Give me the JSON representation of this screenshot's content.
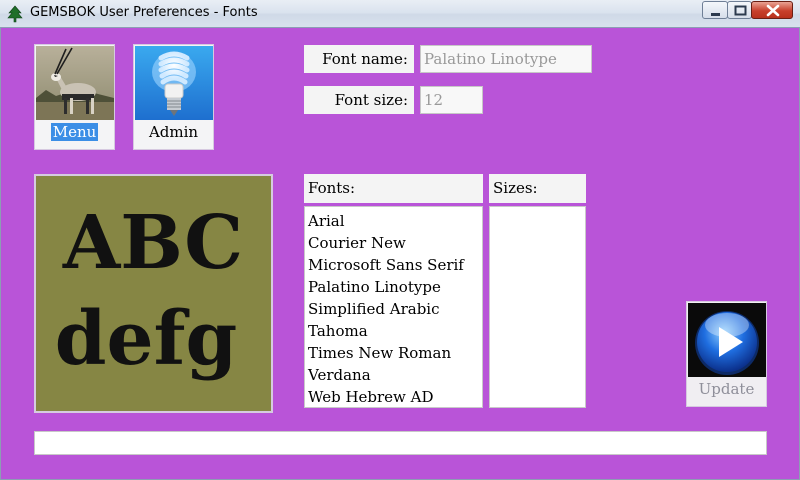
{
  "window": {
    "title": "GEMSBOK User Preferences - Fonts",
    "icon": "tree-icon"
  },
  "tiles": {
    "menu": {
      "label": "Menu",
      "icon": "gemsbok-photo",
      "selected": true
    },
    "admin": {
      "label": "Admin",
      "icon": "light-bulb-icon"
    },
    "update": {
      "label": "Update",
      "icon": "play-icon",
      "disabled": true
    }
  },
  "fields": {
    "font_name": {
      "label": "Font name:",
      "value": "Palatino Linotype"
    },
    "font_size": {
      "label": "Font size:",
      "value": "12"
    }
  },
  "preview": {
    "line1": "ABC",
    "line2": "defg",
    "background": "#868644"
  },
  "fonts_list": {
    "header": "Fonts:",
    "items": [
      "Arial",
      "Courier New",
      "Microsoft Sans Serif",
      "Palatino Linotype",
      "Simplified Arabic",
      "Tahoma",
      "Times New Roman",
      "Verdana",
      "Web Hebrew AD"
    ]
  },
  "sizes_list": {
    "header": "Sizes:",
    "items": []
  },
  "status": {
    "text": ""
  },
  "colors": {
    "background": "#b954d8",
    "selection": "#3b8ee6"
  }
}
